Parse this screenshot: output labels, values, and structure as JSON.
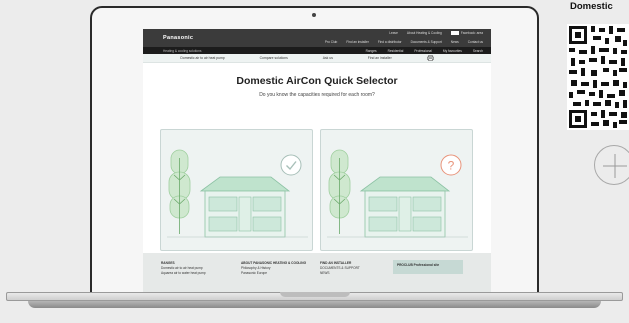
{
  "site": {
    "logo": "Panasonic",
    "util_links": [
      "Pro Club",
      "Find an installer",
      "Find a distributor",
      "Documents & Support",
      "News",
      "Contact us"
    ],
    "util_top": [
      "Leave",
      "About Heating & Cooling",
      "Facebook: area"
    ],
    "nav_left": "Heating & cooling solutions",
    "nav_items": [
      "Ranges",
      "Residential",
      "Professional",
      "My favourites",
      "Search"
    ],
    "tabs": [
      "Domestic air to air heat pump",
      "Compare solutions",
      "Ask us",
      "Find an installer",
      "print"
    ]
  },
  "main": {
    "title": "Domestic AirCon Quick Selector",
    "subtitle": "Do you know the capacities required for each room?",
    "card_1_state": "check",
    "card_2_state": "question",
    "colors": {
      "check_ring": "#a7bfb8",
      "question_ring": "#e8937a",
      "house_green": "#6fbf9a",
      "tree_green": "#8ecf8e"
    }
  },
  "footer": {
    "col1": {
      "heading": "RANGES",
      "items": [
        "Domestic air to air heat pump",
        "Aquarea air to water heat pump"
      ]
    },
    "col2": {
      "heading": "ABOUT PANASONIC HEATING & COOLING",
      "items": [
        "Philosophy & History",
        "Panasonic Europe"
      ]
    },
    "col3": {
      "heading": "FIND AN INSTALLER",
      "items": [
        "DOCUMENTS & SUPPORT",
        "NEWS"
      ]
    },
    "pro": "PROCLUB Professional site"
  },
  "side": {
    "title": "Domestic",
    "plus_icon": "plus-icon"
  }
}
